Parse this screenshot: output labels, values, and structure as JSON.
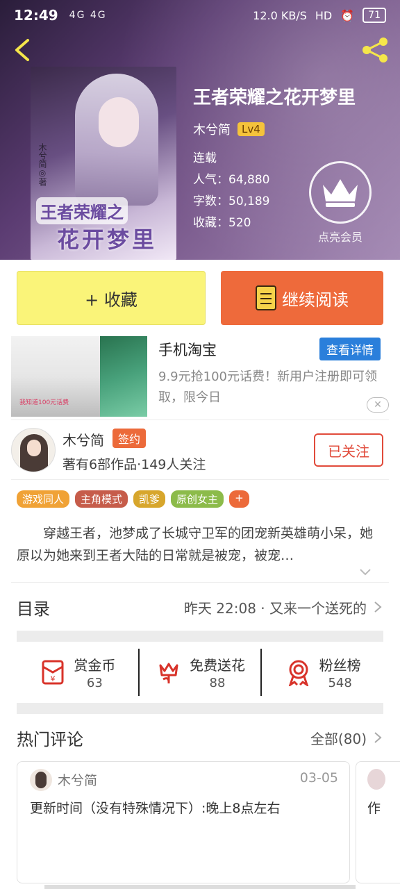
{
  "status_bar": {
    "time": "12:49",
    "signal": "4G 4G",
    "speed": "12.0 KB/S",
    "hd": "HD",
    "battery": "71"
  },
  "book": {
    "title": "王者荣耀之花开梦里",
    "author": "木兮简",
    "level": "Lv4",
    "state": "连载",
    "popularity": "人气：64,880",
    "words": "字数：50,189",
    "collections": "收藏：520",
    "cover_title_1": "王者荣耀之",
    "cover_title_2": "花开梦里",
    "cover_author": "木兮简◎著"
  },
  "vip": {
    "label": "点亮会员"
  },
  "actions": {
    "favorite": "+ 收藏",
    "continue": "继续阅读"
  },
  "ad": {
    "title": "手机淘宝",
    "detail_button": "查看详情",
    "description": "9.9元抢100元话费！新用户注册即可领取，限今日",
    "img_caption": "我知道100元话费",
    "close": "✕"
  },
  "author_panel": {
    "name": "木兮简",
    "badge": "签约",
    "stats": "著有6部作品·149人关注",
    "follow": "已关注"
  },
  "tags": [
    {
      "label": "游戏同人",
      "color": "#f0a236"
    },
    {
      "label": "主角模式",
      "color": "#c65c4a"
    },
    {
      "label": "凯爹",
      "color": "#d7a62c"
    },
    {
      "label": "原创女主",
      "color": "#8cbb4a"
    },
    {
      "label": "+",
      "color": "#ec6a3a"
    }
  ],
  "synopsis": "穿越王者，池梦成了长城守卫军的团宠新英雄萌小呆，她原以为她来到王者大陆的日常就是被宠，被宠…",
  "toc": {
    "label": "目录",
    "latest": "昨天 22:08 · 又来一个送死的"
  },
  "rewards": [
    {
      "name": "赏金币",
      "num": "63",
      "icon": "red-envelope-icon"
    },
    {
      "name": "免费送花",
      "num": "88",
      "icon": "flower-icon"
    },
    {
      "name": "粉丝榜",
      "num": "548",
      "icon": "medal-icon"
    }
  ],
  "comments": {
    "label": "热门评论",
    "all": "全部(80)",
    "first": {
      "user": "木兮简",
      "date": "03-05",
      "content": "更新时间（没有特殊情况下）:晚上8点左右"
    },
    "second": {
      "content": "作"
    }
  },
  "colors": {
    "accent": "#ee6a3b",
    "favorite": "#faf479",
    "detail": "#2a7fdb",
    "follow": "#e14b3b"
  }
}
